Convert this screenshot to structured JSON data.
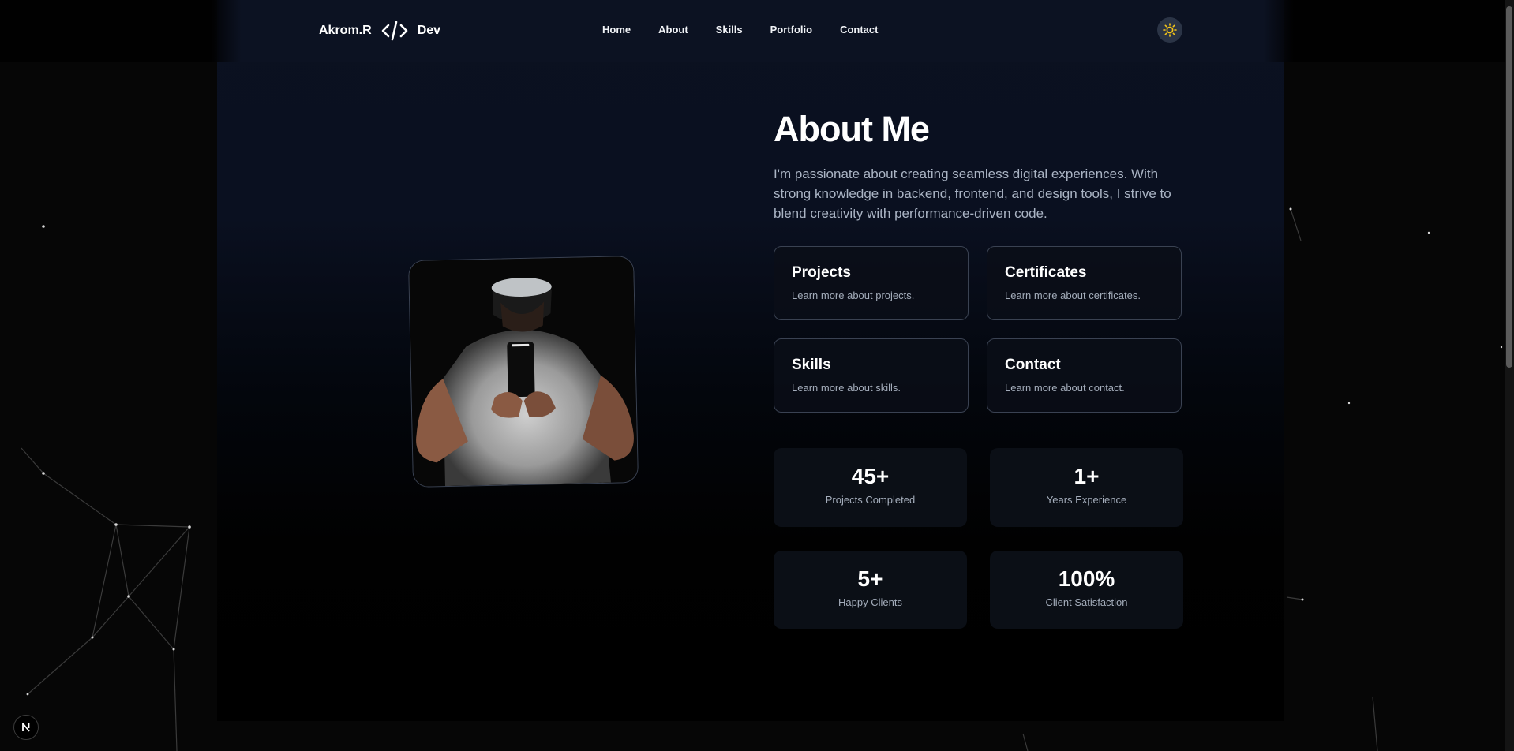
{
  "navbar": {
    "brand_name": "Akrom.R",
    "brand_icon": "code-brackets-icon",
    "brand_suffix": "Dev",
    "links": [
      "Home",
      "About",
      "Skills",
      "Portfolio",
      "Contact"
    ],
    "theme_icon": "sun-icon",
    "accent_color": "#f5c518"
  },
  "about": {
    "title": "About Me",
    "description": "I'm passionate about creating seamless digital experiences. With strong knowledge in backend, frontend, and design tools, I strive to blend creativity with performance-driven code.",
    "photo_alt": "profile-photo"
  },
  "cards": [
    {
      "title": "Projects",
      "subtitle": "Learn more about projects."
    },
    {
      "title": "Certificates",
      "subtitle": "Learn more about certificates."
    },
    {
      "title": "Skills",
      "subtitle": "Learn more about skills."
    },
    {
      "title": "Contact",
      "subtitle": "Learn more about contact."
    }
  ],
  "stats": [
    {
      "value": "45+",
      "label": "Projects Completed"
    },
    {
      "value": "1+",
      "label": "Years Experience"
    },
    {
      "value": "5+",
      "label": "Happy Clients"
    },
    {
      "value": "100%",
      "label": "Client Satisfaction"
    }
  ],
  "badge": {
    "icon": "nextjs-icon",
    "letter": "N"
  }
}
